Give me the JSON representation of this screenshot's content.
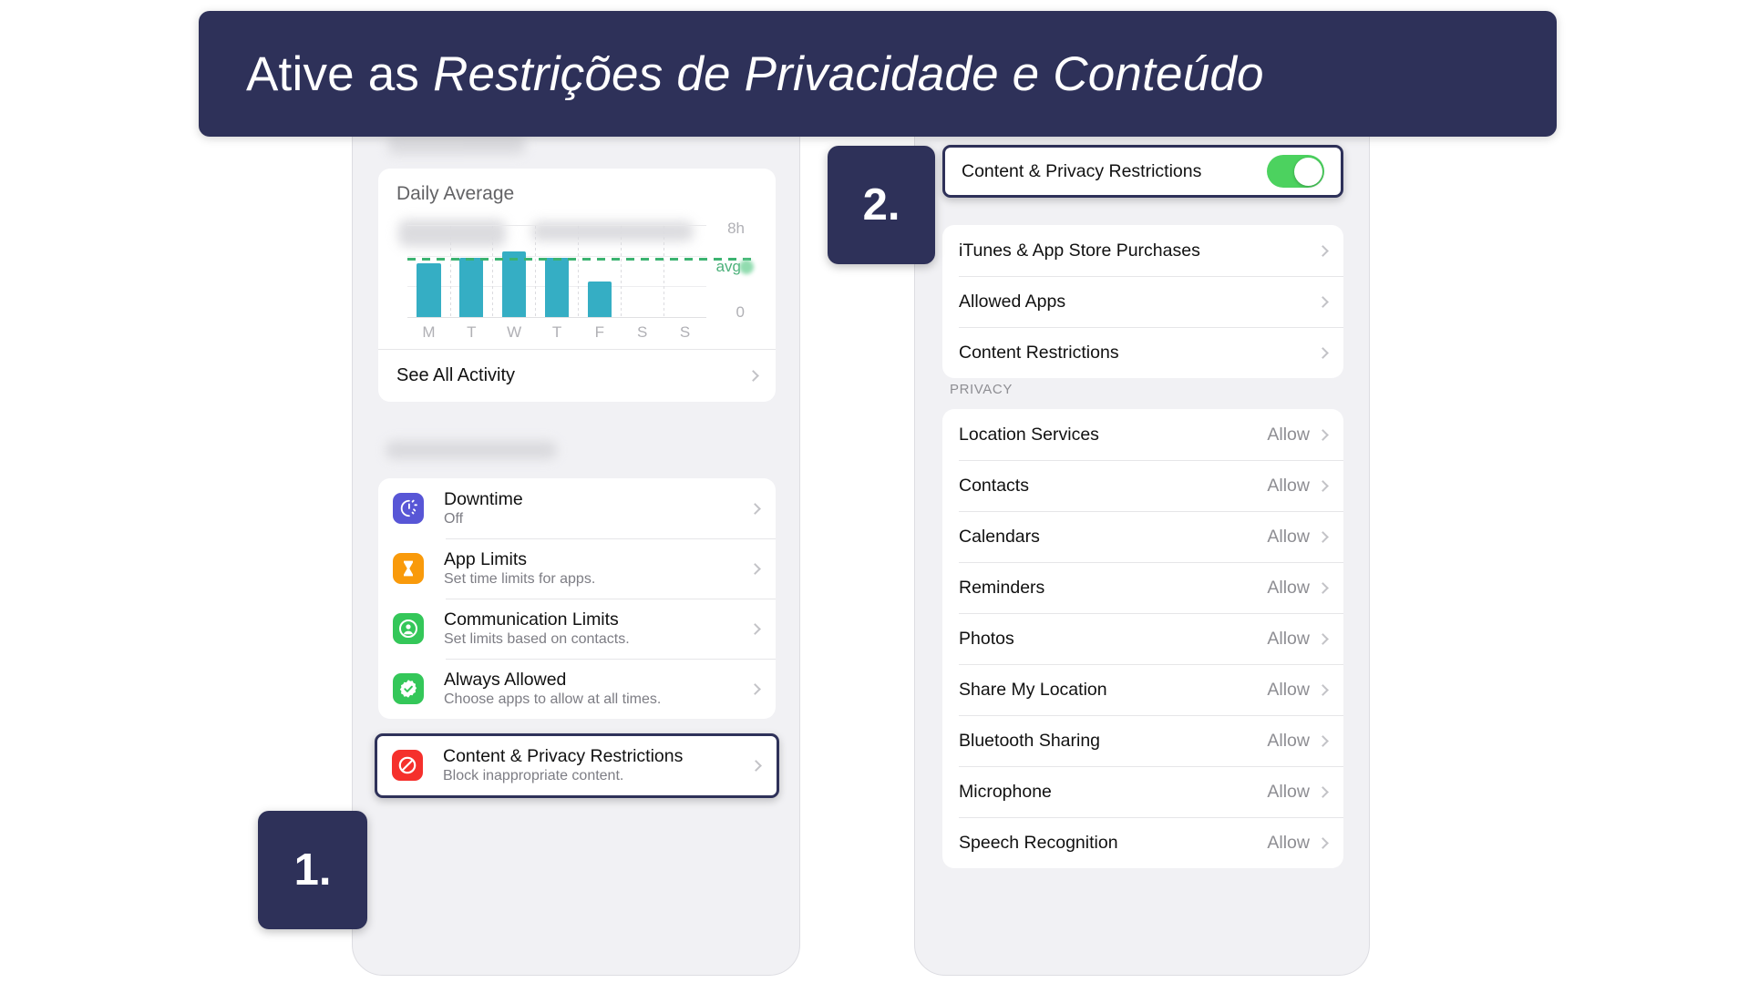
{
  "banner": {
    "text_plain": "Ative as ",
    "text_emphasis": "Restrições de Privacidade e Conteúdo",
    "bg_color": "#2e3159"
  },
  "steps": {
    "one": "1.",
    "two": "2."
  },
  "left_phone": {
    "daily_average": {
      "title": "Daily Average",
      "see_all_label": "See All Activity"
    },
    "settings": [
      {
        "title": "Downtime",
        "subtitle": "Off",
        "icon": "moon-clock-icon",
        "icon_color": "#5856d6"
      },
      {
        "title": "App Limits",
        "subtitle": "Set time limits for apps.",
        "icon": "hourglass-icon",
        "icon_color": "#f99a0b"
      },
      {
        "title": "Communication Limits",
        "subtitle": "Set limits based on contacts.",
        "icon": "person-circle-icon",
        "icon_color": "#34c759"
      },
      {
        "title": "Always Allowed",
        "subtitle": "Choose apps to allow at all times.",
        "icon": "checkmark-seal-icon",
        "icon_color": "#34c759"
      },
      {
        "title": "Content & Privacy Restrictions",
        "subtitle": "Block inappropriate content.",
        "icon": "no-entry-icon",
        "icon_color": "#f5302c"
      }
    ]
  },
  "right_phone": {
    "toggle_row": {
      "label": "Content & Privacy Restrictions",
      "state": "on",
      "on_color": "#4cd25f"
    },
    "restriction_items": [
      {
        "label": "iTunes & App Store Purchases"
      },
      {
        "label": "Allowed Apps"
      },
      {
        "label": "Content Restrictions"
      }
    ],
    "privacy_header": "PRIVACY",
    "privacy_items": [
      {
        "label": "Location Services",
        "value": "Allow"
      },
      {
        "label": "Contacts",
        "value": "Allow"
      },
      {
        "label": "Calendars",
        "value": "Allow"
      },
      {
        "label": "Reminders",
        "value": "Allow"
      },
      {
        "label": "Photos",
        "value": "Allow"
      },
      {
        "label": "Share My Location",
        "value": "Allow"
      },
      {
        "label": "Bluetooth Sharing",
        "value": "Allow"
      },
      {
        "label": "Microphone",
        "value": "Allow"
      },
      {
        "label": "Speech Recognition",
        "value": "Allow"
      }
    ]
  },
  "chart_data": {
    "type": "bar",
    "title": "Daily Average",
    "categories": [
      "M",
      "T",
      "W",
      "T",
      "F",
      "S",
      "S"
    ],
    "values": [
      4.7,
      5.2,
      5.8,
      5.2,
      3.1,
      0,
      0
    ],
    "ylim": [
      0,
      8
    ],
    "ytick_labels": [
      "8h",
      "0"
    ],
    "xlabel": "",
    "ylabel": "",
    "grid": true,
    "legend": "none",
    "annotations": [
      {
        "type": "average-line",
        "label": "avg",
        "value": 5.0,
        "color": "#3cb371",
        "style": "dashed"
      }
    ],
    "bar_color": "#35aec4"
  }
}
